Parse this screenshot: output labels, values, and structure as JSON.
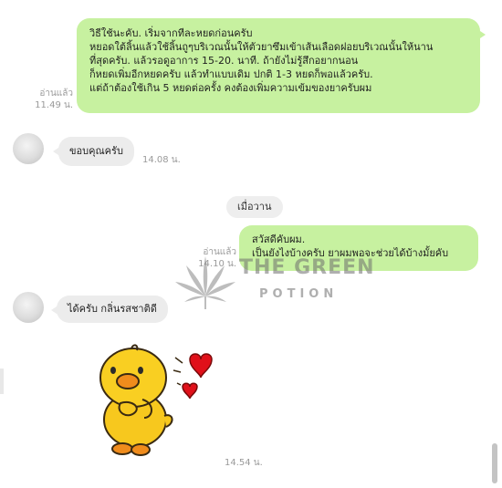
{
  "messages": [
    {
      "direction": "outgoing",
      "lines": [
        "วิธีใช้นะคับ.   เริ่มจากทีละหยดก่อนครับ",
        "หยอดใต้ลิ้นแล้วใช้ลิ้นถูๆบริเวณนั้นให้ตัวยาซึมเข้าเส้นเลือดฝอยบริเวณนั้นให้นาน",
        "ที่สุดครับ.  แล้วรอดูอาการ  15-20. นาที. ถ้ายังไม่รู้สึกอยากนอน",
        "ก็หยดเพิ่มอีกหยดครับ  แล้วทำแบบเดิม  ปกติ  1-3  หยดก็พอแล้วครับ.",
        "แต่ถ้าต้องใช้เกิน  5 หยดต่อครั้ง  คงต้องเพิ่มความเข้มของยาครับผม"
      ],
      "read_label": "อ่านแล้ว",
      "time": "11.49 น."
    },
    {
      "direction": "incoming",
      "text": "ขอบคุณครับ",
      "time": "14.08 น."
    },
    {
      "direction": "outgoing",
      "lines": [
        "สวัสดีคับผม.",
        "เป็นยังไงบ้างครับ ยาผมพอจะช่วยได้บ้างมั้ยคับ"
      ],
      "read_label": "อ่านแล้ว",
      "time": "14.10 น."
    },
    {
      "direction": "incoming",
      "text": "ได้ครับ กลิ่นรสชาติดี"
    },
    {
      "direction": "incoming",
      "sticker": "duck-hearts-sticker",
      "time": "14.54 น."
    }
  ],
  "date_separator": "เมื่อวาน",
  "watermark": {
    "title": "THE GREEN",
    "subtitle": "POTION"
  },
  "colors": {
    "outgoing_bubble": "#c7f1a0",
    "incoming_bubble": "#ececec",
    "meta_text": "#9a9a9a"
  }
}
